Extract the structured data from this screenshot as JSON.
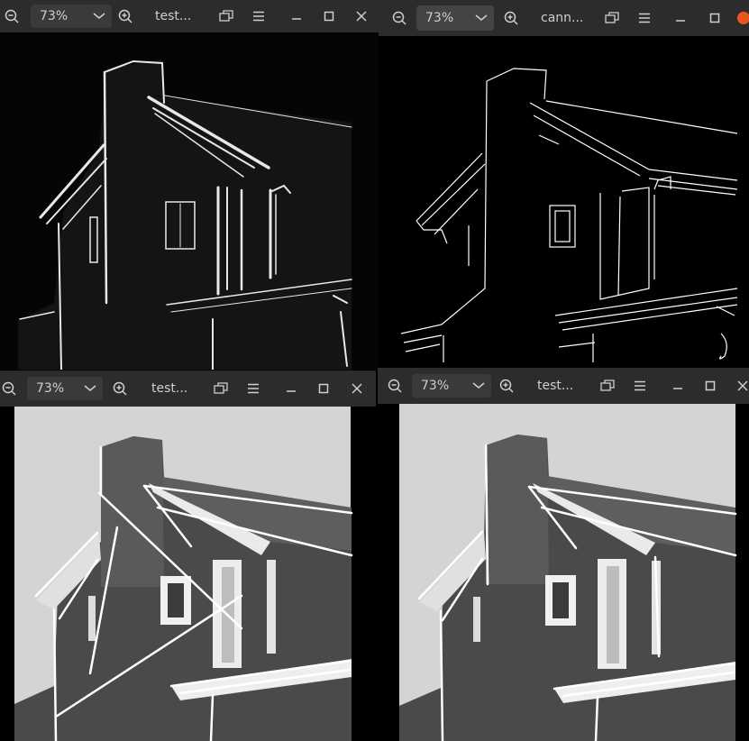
{
  "windows": [
    {
      "id": "w1",
      "zoom": "73%",
      "title": "test..."
    },
    {
      "id": "w2",
      "zoom": "73%",
      "title": "cann..."
    },
    {
      "id": "w3",
      "zoom": "73%",
      "title": "test..."
    },
    {
      "id": "w4",
      "zoom": "73%",
      "title": "test..."
    }
  ],
  "colors": {
    "titlebar": "#2c2c2c",
    "accent": "#e95420"
  }
}
